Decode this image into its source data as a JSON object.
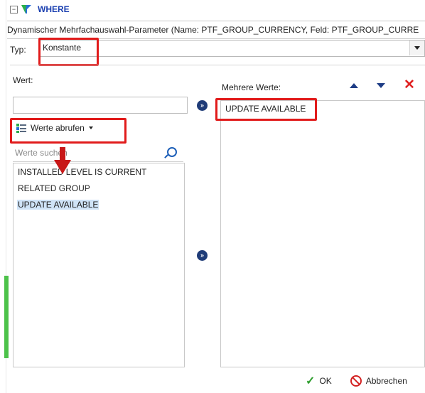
{
  "header": {
    "where_label": "WHERE",
    "collapse_symbol": "⊟",
    "description": "Dynamischer Mehrfachauswahl-Parameter (Name: PTF_GROUP_CURRENCY, Feld: PTF_GROUP_CURRE"
  },
  "typ": {
    "label": "Typ:",
    "value": "Konstante"
  },
  "left_panel": {
    "wert_label": "Wert:",
    "wert_value": "",
    "fetch_button_label": "Werte abrufen",
    "search_placeholder": "Werte suchen",
    "items": [
      {
        "label": "INSTALLED LEVEL IS CURRENT",
        "selected": false
      },
      {
        "label": "RELATED GROUP",
        "selected": false
      },
      {
        "label": "UPDATE AVAILABLE",
        "selected": true
      }
    ]
  },
  "right_panel": {
    "header": "Mehrere Werte:",
    "items": [
      {
        "label": "UPDATE AVAILABLE"
      }
    ]
  },
  "transfer_buttons": {
    "add_symbol": "»",
    "add_all_symbol": "»"
  },
  "footer": {
    "ok_label": "OK",
    "cancel_label": "Abbrechen"
  },
  "colors": {
    "highlight_red": "#e11b1b",
    "where_blue": "#1a3fb0",
    "selection_blue": "#cfe3f7",
    "green_bar": "#4cc24a"
  },
  "icons": [
    "collapse-icon",
    "filter-icon",
    "fetch-icon",
    "search-icon",
    "move-up-icon",
    "move-down-icon",
    "delete-icon",
    "ok-check-icon",
    "cancel-icon"
  ]
}
